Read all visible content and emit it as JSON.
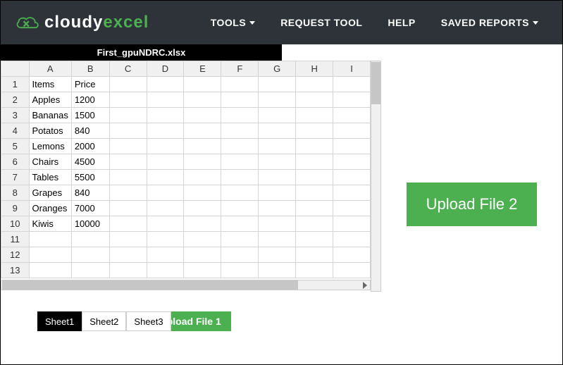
{
  "brand": {
    "part1": "cloudy",
    "part2": "excel"
  },
  "nav": {
    "tools": "TOOLS",
    "request": "REQUEST TOOL",
    "help": "HELP",
    "saved": "SAVED REPORTS"
  },
  "file": {
    "name": "First_gpuNDRC.xlsx"
  },
  "columns": [
    "A",
    "B",
    "C",
    "D",
    "E",
    "F",
    "G",
    "H",
    "I"
  ],
  "rows": [
    {
      "n": "1",
      "a": "Items",
      "b": "Price"
    },
    {
      "n": "2",
      "a": "Apples",
      "b": "1200"
    },
    {
      "n": "3",
      "a": "Bananas",
      "b": "1500"
    },
    {
      "n": "4",
      "a": "Potatos",
      "b": "840"
    },
    {
      "n": "5",
      "a": "Lemons",
      "b": "2000"
    },
    {
      "n": "6",
      "a": "Chairs",
      "b": "4500"
    },
    {
      "n": "7",
      "a": "Tables",
      "b": "5500"
    },
    {
      "n": "8",
      "a": "Grapes",
      "b": "840"
    },
    {
      "n": "9",
      "a": "Oranges",
      "b": "7000"
    },
    {
      "n": "10",
      "a": "Kiwis",
      "b": "10000"
    },
    {
      "n": "11",
      "a": "",
      "b": ""
    },
    {
      "n": "12",
      "a": "",
      "b": ""
    },
    {
      "n": "13",
      "a": "",
      "b": ""
    }
  ],
  "sheets": {
    "s1": "Sheet1",
    "s2": "Sheet2",
    "s3": "Sheet3"
  },
  "buttons": {
    "upload1": "Upload File 1",
    "upload2": "Upload File 2"
  }
}
